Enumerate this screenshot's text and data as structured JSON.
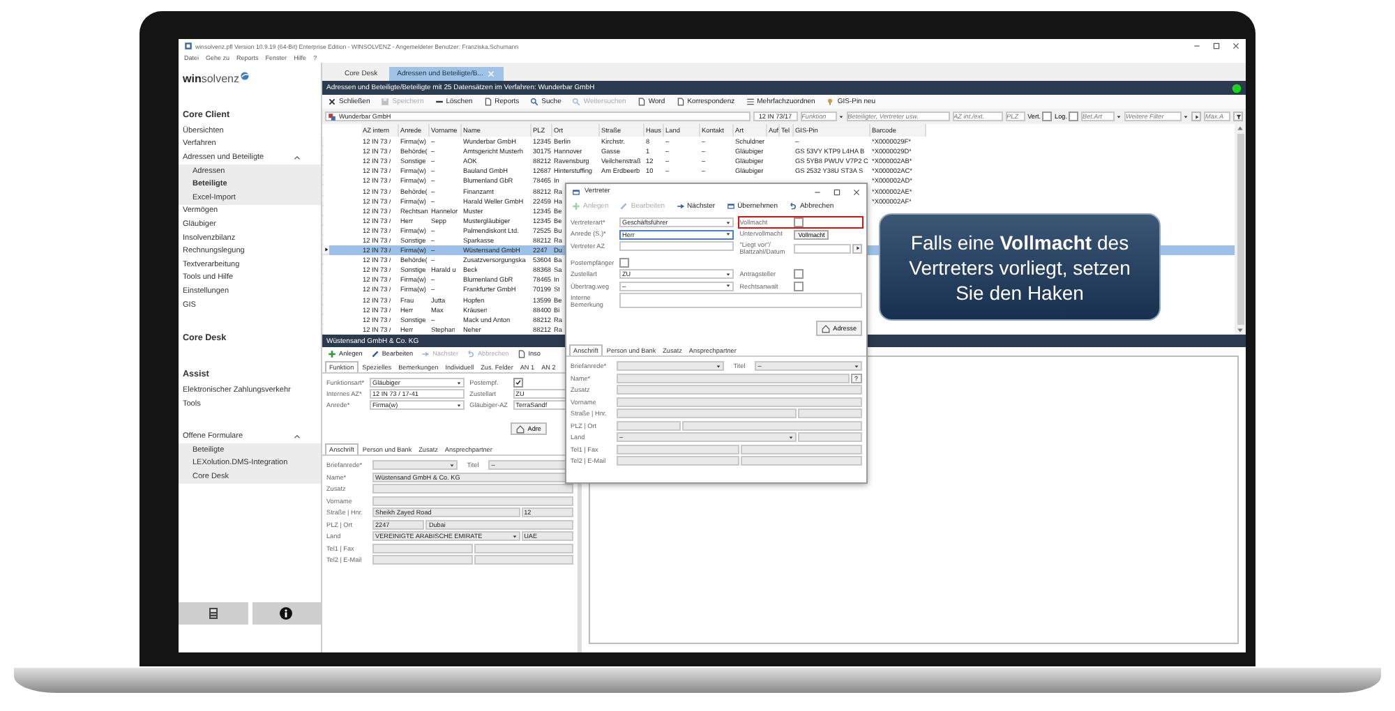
{
  "window": {
    "title": "winsolvenz.pfl Version 10.9.19 (64-Bit) Enterprise Edition - WINSOLVENZ - Angemeldeter Benutzer: Franziska.Schumann",
    "menu": [
      "Datei",
      "Gehe zu",
      "Reports",
      "Fenster",
      "Hilfe",
      "?"
    ]
  },
  "sidebar": {
    "logo": "**win**solvenz",
    "sections": [
      {
        "title": "Core Client",
        "items": [
          {
            "label": "Übersichten",
            "selected": false
          },
          {
            "label": "Verfahren",
            "selected": false
          },
          {
            "label": "Adressen und Beteiligte",
            "selected": false,
            "expanded": true,
            "children": [
              {
                "label": "Adressen",
                "selected": false
              },
              {
                "label": "Beteiligte",
                "selected": true
              },
              {
                "label": "Excel-Import",
                "selected": false
              }
            ]
          },
          {
            "label": "Vermögen",
            "selected": false
          },
          {
            "label": "Gläubiger",
            "selected": false
          },
          {
            "label": "Insolvenzbilanz",
            "selected": false
          },
          {
            "label": "Rechnungslegung",
            "selected": false
          },
          {
            "label": "Textverarbeitung",
            "selected": false
          },
          {
            "label": "Tools und Hilfe",
            "selected": false
          },
          {
            "label": "Einstellungen",
            "selected": false
          },
          {
            "label": "GIS",
            "selected": false
          }
        ]
      },
      {
        "title": "Core Desk"
      },
      {
        "title": "Assist",
        "items": [
          {
            "label": "Elektronischer Zahlungsverkehr",
            "selected": false
          },
          {
            "label": "Tools",
            "selected": false
          }
        ]
      },
      {
        "items": [
          {
            "label": "Offene Formulare",
            "selected": false,
            "expanded": true,
            "children": [
              {
                "label": "Beteiligte",
                "selected": false
              },
              {
                "label": "LEXolution.DMS-Integration",
                "selected": false
              },
              {
                "label": "Core Desk",
                "selected": false
              }
            ]
          }
        ]
      }
    ]
  },
  "tabs": [
    {
      "label": "Core Desk",
      "selected": false,
      "closable": false
    },
    {
      "label": "Adressen und Beteiligte/B...",
      "selected": true,
      "closable": true
    }
  ],
  "header": "Adressen und Beteiligte/Beteiligte mit 25 Datensätzen im Verfahren: Wunderbar GmbH",
  "toolbar": [
    {
      "label": "Schließen",
      "disabled": false
    },
    {
      "label": "Speichern",
      "disabled": true
    },
    {
      "label": "Löschen",
      "disabled": false
    },
    {
      "label": "Reports",
      "disabled": false
    },
    {
      "label": "Suche",
      "disabled": false
    },
    {
      "label": "Weitersuchen",
      "disabled": true
    },
    {
      "label": "Word",
      "disabled": false
    },
    {
      "label": "Korrespondenz",
      "disabled": false
    },
    {
      "label": "Mehrfachzuordnen",
      "disabled": false
    },
    {
      "label": "GIS-Pin neu",
      "disabled": false
    }
  ],
  "filters": [
    {
      "kind": "search",
      "value": "Wunderbar GmbH"
    },
    {
      "kind": "text",
      "value": "12 IN 73/17"
    },
    {
      "kind": "select",
      "placeholder": "Funktion"
    },
    {
      "kind": "text",
      "placeholder": "Beteiligter, Vertreter usw."
    },
    {
      "kind": "text",
      "placeholder": "AZ int./ext."
    },
    {
      "kind": "text",
      "placeholder": "PLZ"
    },
    {
      "kind": "check",
      "label": "Vert.",
      "checked": false
    },
    {
      "kind": "check",
      "label": "Log.",
      "checked": false
    },
    {
      "kind": "select",
      "placeholder": "Bet.Art"
    },
    {
      "kind": "select",
      "placeholder": "Weitere Filter"
    },
    {
      "kind": "next"
    },
    {
      "kind": "text",
      "placeholder": "Max.A"
    },
    {
      "kind": "filter"
    }
  ],
  "table": {
    "columns": [
      "AZ intern",
      "Anrede",
      "Vorname",
      "Name",
      "PLZ",
      "Ort",
      "Straße",
      "Haus",
      "Land",
      "Kontakt",
      "Art",
      "Auf",
      "Tel",
      "GIS-Pin",
      "Barcode"
    ],
    "rows": [
      {
        "selected": false,
        "cells": [
          "12 IN 73 /",
          "Firma(w)",
          "–",
          "Wunderbar GmbH",
          "12345",
          "Berlin",
          "Kirchstr.",
          "8",
          "–",
          "–",
          "Schuldner",
          null,
          null,
          "–",
          "*X0000029F*"
        ]
      },
      {
        "selected": false,
        "cells": [
          "12 IN 73 /",
          "Behörde(",
          "–",
          "Amtsgericht Musterh",
          "30175",
          "Hannover",
          "Gasse",
          "1",
          "–",
          "–",
          "Gläubiger",
          null,
          null,
          "GS 53VY KTP9 L4HA B",
          "*X0000029D*"
        ]
      },
      {
        "selected": false,
        "cells": [
          "12 IN 73 /",
          "Sonstige",
          "–",
          "AOK",
          "88212",
          "Ravensburg",
          "Veilchenstraß",
          "12",
          "–",
          "–",
          "Gläubiger",
          null,
          null,
          "GS 5YB8 PWUV V7P2 C",
          "*X000002AB*"
        ]
      },
      {
        "selected": false,
        "cells": [
          "12 IN 73 /",
          "Firma(w)",
          "–",
          "Bauland GmbH",
          "12687",
          "Hinterstuffing",
          "Am Erdbeerb",
          "10",
          "–",
          "–",
          "Gläubiger",
          null,
          null,
          "GS 2532 Y38U ST3A S",
          "*X000002AC*"
        ]
      },
      {
        "selected": false,
        "cells": [
          "12 IN 73 /",
          "Firma(w)",
          "–",
          "Blumenland GbR",
          "78465",
          "In",
          null,
          null,
          null,
          null,
          null,
          null,
          null,
          null,
          "*X000002AD*"
        ]
      },
      {
        "selected": false,
        "cells": [
          "12 IN 73 /",
          "Behörde(",
          "–",
          "Finanzamt",
          "88212",
          "Ra",
          null,
          null,
          null,
          null,
          null,
          null,
          null,
          null,
          "*X000002AE*"
        ]
      },
      {
        "selected": false,
        "cells": [
          "12 IN 73 /",
          "Firma(w)",
          "–",
          "Harald Weller GmbH",
          "22459",
          "Ha",
          null,
          null,
          null,
          null,
          null,
          null,
          null,
          null,
          "*X000002AF*"
        ]
      },
      {
        "selected": false,
        "cells": [
          "12 IN 73 /",
          "Rechtsan",
          "Hannelor",
          "Muster",
          "12345",
          "Be",
          null,
          null,
          null,
          null,
          null,
          null,
          null,
          null,
          null
        ]
      },
      {
        "selected": false,
        "cells": [
          "12 IN 73 /",
          "Herr",
          "Sepp",
          "Mustergläubiger",
          "12345",
          "Be",
          null,
          null,
          null,
          null,
          null,
          null,
          null,
          null,
          null
        ]
      },
      {
        "selected": false,
        "cells": [
          "12 IN 73 /",
          "Firma(w)",
          "–",
          "Palmendiskont Ltd.",
          "72525",
          "Bu",
          null,
          null,
          null,
          null,
          null,
          null,
          null,
          null,
          null
        ]
      },
      {
        "selected": false,
        "cells": [
          "12 IN 73 /",
          "Sonstige",
          "–",
          "Sparkasse",
          "88212",
          "Ra",
          null,
          null,
          null,
          null,
          null,
          null,
          null,
          null,
          null
        ]
      },
      {
        "selected": true,
        "cells": [
          "12 IN 73 /",
          "Firma(w)",
          "–",
          "Wüstensand GmbH",
          "2247",
          "Du",
          null,
          null,
          null,
          null,
          null,
          null,
          null,
          null,
          null
        ]
      },
      {
        "selected": false,
        "cells": [
          "12 IN 73 /",
          "Behörde(",
          "–",
          "Zusatzversorgungska",
          "53604",
          "Ba",
          null,
          null,
          null,
          null,
          null,
          null,
          null,
          null,
          null
        ]
      },
      {
        "selected": false,
        "cells": [
          "12 IN 73 /",
          "Sonstige",
          "Harald u",
          "Beck",
          "88368",
          "Sa",
          null,
          null,
          null,
          null,
          null,
          null,
          null,
          null,
          null
        ]
      },
      {
        "selected": false,
        "cells": [
          "12 IN 73 /",
          "Firma(w)",
          "–",
          "Blumenland GbR",
          "78465",
          "In",
          null,
          null,
          null,
          null,
          null,
          null,
          null,
          null,
          null
        ]
      },
      {
        "selected": false,
        "cells": [
          "12 IN 73 /",
          "Firma(w)",
          "–",
          "Frankfurter GmbH",
          "70199",
          "St",
          null,
          null,
          null,
          null,
          null,
          null,
          null,
          null,
          null
        ]
      },
      {
        "selected": false,
        "cells": [
          "12 IN 73 /",
          "Frau",
          "Jutta",
          "Hopfen",
          "13599",
          "Be",
          null,
          null,
          null,
          null,
          null,
          null,
          null,
          null,
          null
        ]
      },
      {
        "selected": false,
        "cells": [
          "12 IN 73 /",
          "Herr",
          "Max",
          "Kräusen",
          "88400",
          "Bi",
          null,
          null,
          null,
          null,
          null,
          null,
          null,
          null,
          null
        ]
      },
      {
        "selected": false,
        "cells": [
          "12 IN 73 /",
          "Sonstige",
          "–",
          "Mack und Anton",
          "88212",
          "Ra",
          null,
          null,
          null,
          null,
          null,
          null,
          null,
          null,
          null
        ]
      },
      {
        "selected": false,
        "cells": [
          "12 IN 73 /",
          "Herr",
          "Stephan",
          "Neher",
          "88212",
          "Ra",
          null,
          null,
          null,
          null,
          null,
          null,
          null,
          null,
          null
        ]
      }
    ]
  },
  "panel": {
    "title": "Wüstensand GmbH & Co. KG",
    "toolbar": [
      {
        "label": "Anlegen",
        "disabled": false
      },
      {
        "label": "Bearbeiten",
        "disabled": false
      },
      {
        "label": "Nächster",
        "disabled": true
      },
      {
        "label": "Abbrechen",
        "disabled": true
      },
      {
        "label": "Inso",
        "disabled": false
      }
    ],
    "tabs": [
      {
        "label": "Funktion",
        "selected": true
      },
      {
        "label": "Spezielles",
        "selected": false
      },
      {
        "label": "Bemerkungen",
        "selected": false
      },
      {
        "label": "Individuell",
        "selected": false
      },
      {
        "label": "Zus. Felder",
        "selected": false
      },
      {
        "label": "AN 1",
        "selected": false
      },
      {
        "label": "AN 2",
        "selected": false
      }
    ],
    "form": [
      {
        "left": [
          {
            "kind": "label",
            "text": "Funktionsart*"
          },
          {
            "kind": "select",
            "value": "Gläubiger"
          }
        ],
        "right": [
          {
            "kind": "label",
            "text": "Postempf."
          },
          {
            "kind": "check",
            "checked": true
          }
        ]
      },
      {
        "left": [
          {
            "kind": "label",
            "text": "Internes AZ*"
          },
          {
            "kind": "text",
            "value": "12 IN 73 / 17-41"
          }
        ],
        "right": [
          {
            "kind": "label",
            "text": "Zustellart"
          },
          {
            "kind": "text",
            "value": "ZU"
          }
        ]
      },
      {
        "left": [
          {
            "kind": "label",
            "text": "Anrede*"
          },
          {
            "kind": "select",
            "value": "Firma(w)"
          }
        ],
        "right": [
          {
            "kind": "label",
            "text": "Gläubiger-AZ"
          },
          {
            "kind": "text",
            "value": "TerraSandf"
          }
        ]
      }
    ],
    "action": "Adre",
    "subtabs": [
      {
        "label": "Anschrift",
        "selected": true
      },
      {
        "label": "Person und Bank",
        "selected": false
      },
      {
        "label": "Zusatz",
        "selected": false
      },
      {
        "label": "Ansprechpartner",
        "selected": false
      }
    ],
    "address": [
      {
        "label": "Briefanrede*",
        "fields": [
          {
            "kind": "select"
          },
          {
            "kind": "label",
            "text": "Titel"
          },
          {
            "kind": "select",
            "value": "–"
          }
        ]
      },
      {
        "label": "Name*",
        "fields": [
          {
            "kind": "text",
            "value": "Wüstensand GmbH & Co. KG"
          }
        ]
      },
      {
        "label": "Zusatz",
        "fields": [
          {
            "kind": "text"
          }
        ]
      },
      {
        "label": "Vorname",
        "fields": [
          {
            "kind": "text"
          }
        ]
      },
      {
        "label": "Straße | Hnr.",
        "fields": [
          {
            "kind": "text",
            "value": "Sheikh Zayed Road"
          },
          {
            "kind": "short",
            "value": "12"
          }
        ]
      },
      {
        "label": "PLZ | Ort",
        "fields": [
          {
            "kind": "short",
            "value": "2247"
          },
          {
            "kind": "text",
            "value": "Dubai"
          }
        ]
      },
      {
        "label": "Land",
        "fields": [
          {
            "kind": "select",
            "value": "VEREINIGTE ARABISCHE EMIRATE"
          },
          {
            "kind": "short",
            "value": "UAE"
          }
        ]
      },
      {
        "label": "Tel1 | Fax",
        "fields": [
          {
            "kind": "text"
          },
          {
            "kind": "text"
          }
        ]
      },
      {
        "label": "Tel2 | E-Mail",
        "fields": [
          {
            "kind": "text"
          },
          {
            "kind": "text"
          }
        ]
      }
    ]
  },
  "dialog": {
    "title": "Vertreter",
    "toolbar": [
      {
        "label": "Anlegen",
        "disabled": true
      },
      {
        "label": "Bearbeiten",
        "disabled": true
      },
      {
        "label": "Nächster",
        "disabled": false
      },
      {
        "label": "Übernehmen",
        "disabled": false
      },
      {
        "label": "Abbrechen",
        "disabled": false
      }
    ],
    "form": [
      {
        "left": [
          {
            "kind": "label",
            "text": "Vertreterart*"
          },
          {
            "kind": "select",
            "value": "Geschäftsführer"
          }
        ],
        "right": [
          {
            "kind": "label",
            "text": "Vollmacht"
          },
          {
            "kind": "check",
            "checked": false
          }
        ],
        "highlight": true
      },
      {
        "left": [
          {
            "kind": "label",
            "text": "Anrede (S.)*"
          },
          {
            "kind": "select",
            "value": "Herr",
            "focused": true
          }
        ],
        "right": [
          {
            "kind": "label",
            "text": "Untervollmacht"
          },
          {
            "kind": "button",
            "label": "Vollmacht"
          }
        ]
      },
      {
        "left": [
          {
            "kind": "label",
            "text": "Vertreter AZ"
          },
          {
            "kind": "text"
          }
        ],
        "right": [
          {
            "kind": "label",
            "text": "\"Liegt vor\"/ Blattzahl/Datum"
          },
          {
            "kind": "text"
          },
          {
            "kind": "next"
          }
        ]
      },
      {
        "left": [
          {
            "kind": "label",
            "text": "Postempfänger"
          },
          {
            "kind": "check",
            "checked": false
          }
        ]
      },
      {
        "left": [
          {
            "kind": "label",
            "text": "Zustellart"
          },
          {
            "kind": "select",
            "value": "ZU"
          }
        ],
        "right": [
          {
            "kind": "label",
            "text": "Antragsteller"
          },
          {
            "kind": "check",
            "checked": false
          }
        ]
      },
      {
        "left": [
          {
            "kind": "label",
            "text": "Übertrag.weg"
          },
          {
            "kind": "select",
            "value": "–"
          }
        ],
        "right": [
          {
            "kind": "label",
            "text": "Rechtsanwalt"
          },
          {
            "kind": "check",
            "checked": false
          }
        ]
      },
      {
        "left": [
          {
            "kind": "label",
            "text": "Interne Bemerkung"
          },
          {
            "kind": "area"
          }
        ]
      }
    ],
    "action": "Adresse",
    "tabs": [
      {
        "label": "Anschrift",
        "selected": true
      },
      {
        "label": "Person und Bank",
        "selected": false
      },
      {
        "label": "Zusatz",
        "selected": false
      },
      {
        "label": "Ansprechpartner",
        "selected": false
      }
    ],
    "address": [
      {
        "label": "Briefanrede*",
        "fields": [
          {
            "kind": "select"
          },
          {
            "kind": "label",
            "text": "Titel"
          },
          {
            "kind": "select",
            "value": "–"
          }
        ]
      },
      {
        "label": "Name*",
        "fields": [
          {
            "kind": "text"
          },
          {
            "kind": "button",
            "label": "?"
          }
        ]
      },
      {
        "label": "Zusatz",
        "fields": [
          {
            "kind": "text"
          }
        ]
      },
      {
        "label": "Vorname",
        "fields": [
          {
            "kind": "text"
          }
        ]
      },
      {
        "label": "Straße | Hnr.",
        "fields": [
          {
            "kind": "text"
          },
          {
            "kind": "short"
          }
        ]
      },
      {
        "label": "PLZ | Ort",
        "fields": [
          {
            "kind": "short"
          },
          {
            "kind": "text"
          }
        ]
      },
      {
        "label": "Land",
        "fields": [
          {
            "kind": "select",
            "value": "–"
          },
          {
            "kind": "short"
          }
        ]
      },
      {
        "label": "Tel1 | Fax",
        "fields": [
          {
            "kind": "text"
          },
          {
            "kind": "text"
          }
        ]
      },
      {
        "label": "Tel2 | E-Mail",
        "fields": [
          {
            "kind": "text"
          },
          {
            "kind": "text"
          }
        ]
      }
    ]
  },
  "callout": {
    "text": "Falls eine **Vollmacht** des Vertreters vorliegt, setzen Sie den Haken"
  }
}
